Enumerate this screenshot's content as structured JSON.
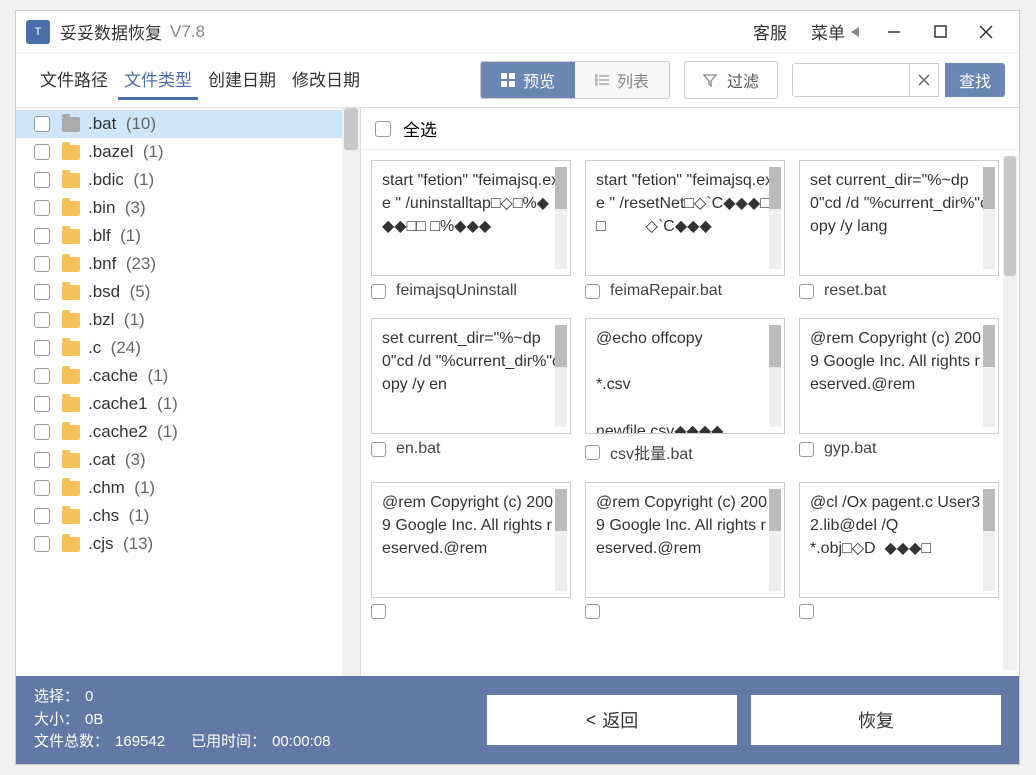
{
  "app": {
    "title": "妥妥数据恢复",
    "version": "V7.8"
  },
  "titlebar": {
    "service": "客服",
    "menu": "菜单"
  },
  "tabs": [
    "文件路径",
    "文件类型",
    "创建日期",
    "修改日期"
  ],
  "active_tab": 1,
  "view": {
    "preview": "预览",
    "list": "列表"
  },
  "filter": "过滤",
  "search": {
    "placeholder": "",
    "button": "查找"
  },
  "select_all": "全选",
  "sidebar": [
    {
      "label": ".bat",
      "count": "(10)",
      "active": true,
      "gray": true
    },
    {
      "label": ".bazel",
      "count": "(1)"
    },
    {
      "label": ".bdic",
      "count": "(1)"
    },
    {
      "label": ".bin",
      "count": "(3)"
    },
    {
      "label": ".blf",
      "count": "(1)"
    },
    {
      "label": ".bnf",
      "count": "(23)"
    },
    {
      "label": ".bsd",
      "count": "(5)"
    },
    {
      "label": ".bzl",
      "count": "(1)"
    },
    {
      "label": ".c",
      "count": "(24)"
    },
    {
      "label": ".cache",
      "count": "(1)"
    },
    {
      "label": ".cache1",
      "count": "(1)"
    },
    {
      "label": ".cache2",
      "count": "(1)"
    },
    {
      "label": ".cat",
      "count": "(3)"
    },
    {
      "label": ".chm",
      "count": "(1)"
    },
    {
      "label": ".chs",
      "count": "(1)"
    },
    {
      "label": ".cjs",
      "count": "(13)"
    }
  ],
  "cards": [
    {
      "text": "start \"fetion\" \"feimajsq.exe \" /uninstalltap□◇□%◆◆◆□□ □%◆◆◆",
      "name": "feimajsqUninstall"
    },
    {
      "text": "start \"fetion\" \"feimajsq.exe \" /resetNet□◇`C◆◆◆□□         ◇`C◆◆◆",
      "name": "feimaRepair.bat"
    },
    {
      "text": "set current_dir=\"%~dp0\"cd /d \"%current_dir%\"copy /y lang",
      "name": "reset.bat"
    },
    {
      "text": "set current_dir=\"%~dp0\"cd /d \"%current_dir%\"copy /y en",
      "name": "en.bat"
    },
    {
      "text": "@echo offcopy\n\n*.csv\n\nnewfile.csv◆◆◆◆",
      "name": "csv批量.bat"
    },
    {
      "text": "@rem Copyright (c) 2009 Google Inc. All rights reserved.@rem",
      "name": "gyp.bat"
    },
    {
      "text": "@rem Copyright (c) 2009 Google Inc. All rights reserved.@rem",
      "name": ""
    },
    {
      "text": "@rem Copyright (c) 2009 Google Inc. All rights reserved.@rem",
      "name": ""
    },
    {
      "text": "@cl /Ox pagent.c User32.lib@del /Q\n*.obj□◇D  ◆◆◆□",
      "name": ""
    }
  ],
  "footer": {
    "selected_label": "选择：",
    "selected": "0",
    "size_label": "大小：",
    "size": "0B",
    "total_label": "文件总数：",
    "total": "169542",
    "time_label": "已用时间：",
    "time": "00:00:08",
    "back": "返回",
    "recover": "恢复"
  }
}
